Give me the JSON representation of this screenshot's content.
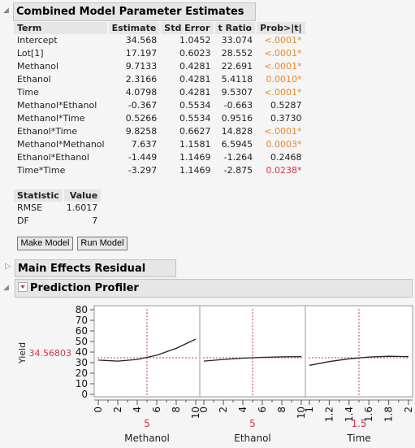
{
  "estimates": {
    "title": "Combined Model Parameter Estimates",
    "columns": [
      "Term",
      "Estimate",
      "Std Error",
      "t Ratio",
      "Prob>|t|"
    ],
    "rows": [
      {
        "term": "Intercept",
        "estimate": "34.568",
        "std_error": "1.0452",
        "t_ratio": "33.074",
        "prob": "<.0001*",
        "sig": "orange"
      },
      {
        "term": "Lot[1]",
        "estimate": "17.197",
        "std_error": "0.6023",
        "t_ratio": "28.552",
        "prob": "<.0001*",
        "sig": "orange"
      },
      {
        "term": "Methanol",
        "estimate": "9.7133",
        "std_error": "0.4281",
        "t_ratio": "22.691",
        "prob": "<.0001*",
        "sig": "orange"
      },
      {
        "term": "Ethanol",
        "estimate": "2.3166",
        "std_error": "0.4281",
        "t_ratio": "5.4118",
        "prob": "0.0010*",
        "sig": "orange"
      },
      {
        "term": "Time",
        "estimate": "4.0798",
        "std_error": "0.4281",
        "t_ratio": "9.5307",
        "prob": "<.0001*",
        "sig": "orange"
      },
      {
        "term": "Methanol*Ethanol",
        "estimate": "-0.367",
        "std_error": "0.5534",
        "t_ratio": "-0.663",
        "prob": "0.5287",
        "sig": "none"
      },
      {
        "term": "Methanol*Time",
        "estimate": "0.5266",
        "std_error": "0.5534",
        "t_ratio": "0.9516",
        "prob": "0.3730",
        "sig": "none"
      },
      {
        "term": "Ethanol*Time",
        "estimate": "9.8258",
        "std_error": "0.6627",
        "t_ratio": "14.828",
        "prob": "<.0001*",
        "sig": "orange"
      },
      {
        "term": "Methanol*Methanol",
        "estimate": "7.637",
        "std_error": "1.1581",
        "t_ratio": "6.5945",
        "prob": "0.0003*",
        "sig": "orange"
      },
      {
        "term": "Ethanol*Ethanol",
        "estimate": "-1.449",
        "std_error": "1.1469",
        "t_ratio": "-1.264",
        "prob": "0.2468",
        "sig": "none"
      },
      {
        "term": "Time*Time",
        "estimate": "-3.297",
        "std_error": "1.1469",
        "t_ratio": "-2.875",
        "prob": "0.0238*",
        "sig": "red"
      }
    ]
  },
  "stats": {
    "columns": [
      "Statistic",
      "Value"
    ],
    "rows": [
      {
        "name": "RMSE",
        "value": "1.6017"
      },
      {
        "name": "DF",
        "value": "7"
      }
    ]
  },
  "buttons": {
    "make_model": "Make Model",
    "run_model": "Run Model"
  },
  "residual_section": {
    "title": "Main Effects Residual Plots"
  },
  "profiler": {
    "title": "Prediction Profiler",
    "response_label": "Yield",
    "response_value": "34.56803",
    "accent_color": "#d9344a"
  },
  "chart_data": {
    "type": "line",
    "title": "Prediction Profiler",
    "ylabel": "Yield",
    "ylim": [
      0,
      80
    ],
    "yticks": [
      "0",
      "10",
      "20",
      "30",
      "40",
      "50",
      "60",
      "70",
      "80"
    ],
    "current_y": 34.56803,
    "grid": false,
    "panels": [
      {
        "factor": "Methanol",
        "current": "5",
        "current_x": 5,
        "xlim": [
          0,
          10
        ],
        "xticks": [
          "0",
          "2",
          "4",
          "6",
          "8",
          "10"
        ],
        "x": [
          0,
          2,
          4,
          6,
          8,
          10
        ],
        "y": [
          32.4,
          31.5,
          33.0,
          37.0,
          43.5,
          52.2
        ]
      },
      {
        "factor": "Ethanol",
        "current": "5",
        "current_x": 5,
        "xlim": [
          0,
          10
        ],
        "xticks": [
          "0",
          "2",
          "4",
          "6",
          "8",
          "10"
        ],
        "x": [
          0,
          2,
          4,
          6,
          8,
          10
        ],
        "y": [
          31.5,
          33.0,
          34.2,
          35.0,
          35.5,
          35.7
        ]
      },
      {
        "factor": "Time",
        "current": "1.5",
        "current_x": 1.5,
        "xlim": [
          1,
          2
        ],
        "xticks": [
          "1",
          "1.2",
          "1.4",
          "1.6",
          "1.8",
          "2"
        ],
        "x": [
          1.0,
          1.2,
          1.4,
          1.6,
          1.8,
          2.0
        ],
        "y": [
          27.5,
          31.0,
          33.6,
          35.3,
          36.0,
          35.7
        ]
      }
    ]
  }
}
